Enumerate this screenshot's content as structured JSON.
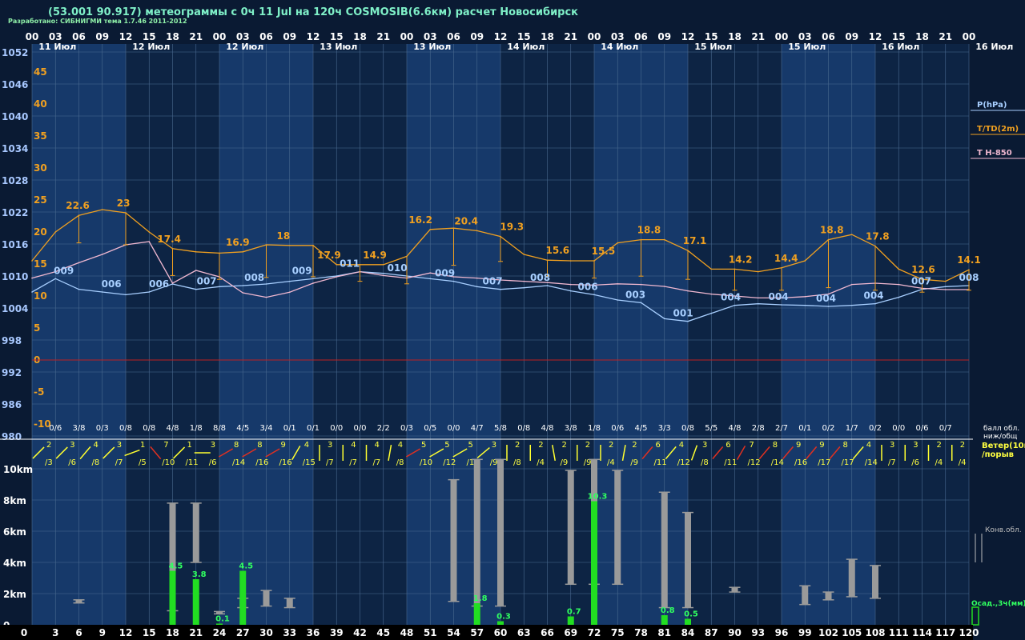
{
  "header": {
    "title": "(53.001 90.917) метеограммы с  0ч 11 Jul на 120ч COSMOSIB(6.6км) расчет Новосибирск",
    "credits": "Разработано: СИБНИГМИ тема 1.7.46 2011-2012"
  },
  "colors": {
    "background": "#0a1a33",
    "band_light": "#16396a",
    "band_dark": "#0d2444",
    "grid": "#4a6a8f",
    "pressure": "#a8cfff",
    "temperature": "#f0a020",
    "t850": "#f0b8d0",
    "zero_line": "#c02020",
    "cloud_bar": "#9a9a9a",
    "precip_bar": "#22dd22",
    "wind_normal": "#ffff30",
    "wind_strong": "#e03020",
    "label_yellow": "#ffff40",
    "label_green": "#30ff60"
  },
  "chart_data": {
    "type": "line",
    "x": [
      0,
      3,
      6,
      9,
      12,
      15,
      18,
      21,
      24,
      27,
      30,
      33,
      36,
      39,
      42,
      45,
      48,
      51,
      54,
      57,
      60,
      63,
      66,
      69,
      72,
      75,
      78,
      81,
      84,
      87,
      90,
      93,
      96,
      99,
      102,
      105,
      108,
      111,
      114,
      117,
      120
    ],
    "top_hour_labels": [
      "00",
      "03",
      "06",
      "09",
      "12",
      "15",
      "18",
      "21",
      "00",
      "03",
      "06",
      "09",
      "12",
      "15",
      "18",
      "21",
      "00",
      "03",
      "06",
      "09",
      "12",
      "15",
      "18",
      "21",
      "00",
      "03",
      "06",
      "09",
      "12",
      "15",
      "18",
      "21",
      "00",
      "03",
      "06",
      "09",
      "12",
      "15",
      "18",
      "21",
      "00"
    ],
    "bottom_hour_labels": [
      "0",
      "3",
      "6",
      "9",
      "12",
      "15",
      "18",
      "21",
      "24",
      "27",
      "30",
      "33",
      "36",
      "39",
      "42",
      "45",
      "48",
      "51",
      "54",
      "57",
      "60",
      "63",
      "66",
      "69",
      "72",
      "75",
      "78",
      "81",
      "84",
      "87",
      "90",
      "93",
      "96",
      "99",
      "102",
      "105",
      "108",
      "111",
      "114",
      "117",
      "120"
    ],
    "day_labels": [
      {
        "hour": 1,
        "text": "11 Июл"
      },
      {
        "hour": 13,
        "text": "12 Июл"
      },
      {
        "hour": 25,
        "text": "12 Июл"
      },
      {
        "hour": 37,
        "text": "13 Июл"
      },
      {
        "hour": 49,
        "text": "13 Июл"
      },
      {
        "hour": 61,
        "text": "14 Июл"
      },
      {
        "hour": 73,
        "text": "14 Июл"
      },
      {
        "hour": 85,
        "text": "15 Июл"
      },
      {
        "hour": 97,
        "text": "15 Июл"
      },
      {
        "hour": 109,
        "text": "16 Июл"
      },
      {
        "hour": 121,
        "text": "16 Июл"
      }
    ],
    "pressure_axis": {
      "ticks": [
        "1052",
        "1046",
        "1040",
        "1034",
        "1028",
        "1022",
        "1016",
        "1010",
        "1004",
        "998",
        "992",
        "986",
        "980"
      ],
      "range": [
        980,
        1054
      ]
    },
    "temperature_axis": {
      "ticks": [
        "45",
        "40",
        "35",
        "30",
        "25",
        "20",
        "15",
        "10",
        "5",
        "0",
        "-5",
        "-10"
      ]
    },
    "legend": [
      "P(hPa)",
      "T/TD(2m)",
      "T H-850"
    ],
    "series": [
      {
        "name": "P(hPa)",
        "values": [
          1007,
          1009.5,
          1007.5,
          1007,
          1006.5,
          1007,
          1008.5,
          1007.5,
          1008,
          1008.2,
          1008.5,
          1009,
          1009.5,
          1010,
          1010.8,
          1010.5,
          1010,
          1009.5,
          1009,
          1008,
          1007.5,
          1007.8,
          1008.2,
          1007.2,
          1006.5,
          1005.5,
          1005,
          1002,
          1001.5,
          1003,
          1004.5,
          1004.8,
          1004.6,
          1004.5,
          1004.3,
          1004.5,
          1004.8,
          1006,
          1007.5,
          1008,
          1008.2
        ]
      },
      {
        "name": "T/TD(2m)",
        "values": [
          15.5,
          20,
          22.6,
          23.5,
          23,
          20,
          17.4,
          16.9,
          16.7,
          16.9,
          18,
          17.9,
          17.9,
          14.9,
          14.9,
          14.9,
          16.2,
          20.4,
          20.6,
          20.2,
          19.3,
          16.5,
          15.6,
          15.5,
          15.5,
          18.3,
          18.8,
          18.8,
          17.1,
          14.2,
          14.2,
          13.8,
          14.4,
          15.5,
          18.8,
          19.6,
          17.8,
          14.2,
          12.6,
          12.3,
          14.1
        ]
      },
      {
        "name": "T H-850",
        "values": [
          12.8,
          13.8,
          15.2,
          16.5,
          18,
          18.5,
          12,
          14,
          13,
          10.5,
          9.8,
          10.6,
          12,
          13,
          13.8,
          13.2,
          12.8,
          13.6,
          13,
          12.8,
          12.5,
          12.3,
          12.1,
          11.8,
          11.7,
          11.9,
          11.8,
          11.5,
          10.8,
          10.3,
          10,
          9.7,
          9.7,
          9.9,
          10.3,
          11.8,
          12,
          11.8,
          11.2,
          11,
          11
        ]
      }
    ],
    "dewpoint_ticks": [
      15.5,
      17.8,
      18.3,
      18.2,
      18,
      17.9,
      13.2,
      12.9,
      12.6,
      12.8,
      12.9,
      13.0,
      13.0,
      11.8,
      12.3,
      11.4,
      11.9,
      12.9,
      14.8,
      15.5,
      15.4,
      13.4,
      13.1,
      12.9,
      12.8,
      13.4,
      13.1,
      13.0,
      12.6,
      10.8,
      10.9,
      10.6,
      10.9,
      11.0,
      11.3,
      11.2,
      10.9,
      10.6,
      10.6,
      10.6,
      10.9
    ],
    "pressure_labels": [
      {
        "hour": 6,
        "text": "009"
      },
      {
        "hour": 15,
        "text": "006"
      },
      {
        "hour": 24,
        "text": "006"
      },
      {
        "hour": 33,
        "text": "007"
      },
      {
        "hour": 42,
        "text": "008"
      },
      {
        "hour": 51,
        "text": "009"
      },
      {
        "hour": 60,
        "text": "011"
      },
      {
        "hour": 69,
        "text": "010"
      },
      {
        "hour": 78,
        "text": "009"
      },
      {
        "hour": 87,
        "text": "007"
      },
      {
        "hour": 96,
        "text": "008"
      },
      {
        "hour": 105,
        "text": "006"
      },
      {
        "hour": 114,
        "text": "003"
      },
      {
        "hour": 123,
        "text": "001"
      },
      {
        "hour": 132,
        "text": "004"
      },
      {
        "hour": 141,
        "text": "004"
      },
      {
        "hour": 150,
        "text": "004"
      },
      {
        "hour": 159,
        "text": "004"
      },
      {
        "hour": 168,
        "text": "007"
      },
      {
        "hour": 177,
        "text": "008"
      }
    ],
    "temperature_labels": [
      {
        "hour": 6,
        "text": "22.6"
      },
      {
        "hour": 12,
        "text": "23"
      },
      {
        "hour": 18,
        "text": "17.4"
      },
      {
        "hour": 27,
        "text": "16.9"
      },
      {
        "hour": 33,
        "text": "18"
      },
      {
        "hour": 39,
        "text": "17.9"
      },
      {
        "hour": 45,
        "text": "14.9"
      },
      {
        "hour": 51,
        "text": "16.2"
      },
      {
        "hour": 57,
        "text": "20.4"
      },
      {
        "hour": 63,
        "text": "19.3"
      },
      {
        "hour": 69,
        "text": "15.6"
      },
      {
        "hour": 75,
        "text": "15.5"
      },
      {
        "hour": 81,
        "text": "18.8"
      },
      {
        "hour": 87,
        "text": "17.1"
      },
      {
        "hour": 93,
        "text": "14.2"
      },
      {
        "hour": 99,
        "text": "14.4"
      },
      {
        "hour": 105,
        "text": "18.8"
      },
      {
        "hour": 111,
        "text": "17.8"
      },
      {
        "hour": 117,
        "text": "12.6"
      },
      {
        "hour": 123,
        "text": "14.1"
      }
    ],
    "cloudiness_label": "балл обл.\nниж/общ",
    "cloudiness": [
      "0/6",
      "3/8",
      "0/3",
      "0/8",
      "0/8",
      "4/8",
      "1/8",
      "8/8",
      "4/5",
      "3/4",
      "0/1",
      "0/1",
      "0/0",
      "0/0",
      "2/2",
      "0/3",
      "0/5",
      "0/0",
      "4/7",
      "5/8",
      "0/8",
      "4/8",
      "3/8",
      "1/8",
      "0/6",
      "4/5",
      "3/3",
      "0/8",
      "5/5",
      "4/8",
      "2/8",
      "2/7",
      "0/1",
      "0/2",
      "1/7",
      "0/2",
      "0/0",
      "0/6",
      "0/7"
    ],
    "wind_label": "Ветер(10м)\n/порыв",
    "wind": [
      {
        "speed": "2",
        "gust": "/3",
        "dir": 225,
        "strong": false
      },
      {
        "speed": "3",
        "gust": "/6",
        "dir": 225,
        "strong": false
      },
      {
        "speed": "4",
        "gust": "/8",
        "dir": 220,
        "strong": false
      },
      {
        "speed": "3",
        "gust": "/7",
        "dir": 225,
        "strong": false
      },
      {
        "speed": "1",
        "gust": "/5",
        "dir": 250,
        "strong": false
      },
      {
        "speed": "7",
        "gust": "/10",
        "dir": 140,
        "strong": true
      },
      {
        "speed": "1",
        "gust": "/11",
        "dir": 225,
        "strong": false
      },
      {
        "speed": "3",
        "gust": "/6",
        "dir": 270,
        "strong": false
      },
      {
        "speed": "8",
        "gust": "/14",
        "dir": 240,
        "strong": true
      },
      {
        "speed": "8",
        "gust": "/16",
        "dir": 240,
        "strong": true
      },
      {
        "speed": "9",
        "gust": "/16",
        "dir": 240,
        "strong": true
      },
      {
        "speed": "4",
        "gust": "/15",
        "dir": 210,
        "strong": false
      },
      {
        "speed": "3",
        "gust": "/7",
        "dir": 180,
        "strong": false
      },
      {
        "speed": "4",
        "gust": "/7",
        "dir": 180,
        "strong": false
      },
      {
        "speed": "4",
        "gust": "/7",
        "dir": 180,
        "strong": false
      },
      {
        "speed": "4",
        "gust": "/8",
        "dir": 190,
        "strong": false
      },
      {
        "speed": "5",
        "gust": "/10",
        "dir": 240,
        "strong": true
      },
      {
        "speed": "5",
        "gust": "/12",
        "dir": 240,
        "strong": false
      },
      {
        "speed": "5",
        "gust": "/12",
        "dir": 240,
        "strong": false
      },
      {
        "speed": "3",
        "gust": "/9",
        "dir": 230,
        "strong": false
      },
      {
        "speed": "2",
        "gust": "/8",
        "dir": 180,
        "strong": false
      },
      {
        "speed": "2",
        "gust": "/4",
        "dir": 180,
        "strong": false
      },
      {
        "speed": "2",
        "gust": "/9",
        "dir": 170,
        "strong": false
      },
      {
        "speed": "2",
        "gust": "/9",
        "dir": 180,
        "strong": false
      },
      {
        "speed": "2",
        "gust": "/4",
        "dir": 180,
        "strong": false
      },
      {
        "speed": "2",
        "gust": "/9",
        "dir": 190,
        "strong": false
      },
      {
        "speed": "6",
        "gust": "/11",
        "dir": 220,
        "strong": true
      },
      {
        "speed": "4",
        "gust": "/12",
        "dir": 220,
        "strong": false
      },
      {
        "speed": "3",
        "gust": "/8",
        "dir": 200,
        "strong": false
      },
      {
        "speed": "6",
        "gust": "/11",
        "dir": 220,
        "strong": true
      },
      {
        "speed": "7",
        "gust": "/12",
        "dir": 210,
        "strong": true
      },
      {
        "speed": "8",
        "gust": "/14",
        "dir": 220,
        "strong": true
      },
      {
        "speed": "9",
        "gust": "/16",
        "dir": 220,
        "strong": true
      },
      {
        "speed": "9",
        "gust": "/17",
        "dir": 220,
        "strong": true
      },
      {
        "speed": "8",
        "gust": "/17",
        "dir": 220,
        "strong": true
      },
      {
        "speed": "4",
        "gust": "/14",
        "dir": 220,
        "strong": false
      },
      {
        "speed": "3",
        "gust": "/7",
        "dir": 180,
        "strong": false
      },
      {
        "speed": "3",
        "gust": "/6",
        "dir": 180,
        "strong": false
      },
      {
        "speed": "2",
        "gust": "/4",
        "dir": 180,
        "strong": false
      },
      {
        "speed": "2",
        "gust": "/4",
        "dir": 180,
        "strong": false
      }
    ],
    "height_axis": {
      "ticks": [
        "10km",
        "8km",
        "6km",
        "4km",
        "2km",
        "0"
      ],
      "range_km": [
        0,
        10.5
      ]
    },
    "convective_label": "Конв.обл.",
    "precip_label": "Осад.,3ч(мм)",
    "convective_clouds": [
      {
        "hour": 6,
        "base": 1.4,
        "top": 1.6
      },
      {
        "hour": 18,
        "base": 0.9,
        "top": 7.8
      },
      {
        "hour": 21,
        "base": 4.0,
        "top": 7.8
      },
      {
        "hour": 24,
        "base": 0.7,
        "top": 0.85
      },
      {
        "hour": 27,
        "base": 1.1,
        "top": 1.7
      },
      {
        "hour": 30,
        "base": 1.2,
        "top": 2.2
      },
      {
        "hour": 33,
        "base": 1.1,
        "top": 1.7
      },
      {
        "hour": 54,
        "base": 1.5,
        "top": 9.3
      },
      {
        "hour": 57,
        "base": 1.2,
        "top": 10.6
      },
      {
        "hour": 60,
        "base": 1.2,
        "top": 10.6
      },
      {
        "hour": 69,
        "base": 2.6,
        "top": 9.9
      },
      {
        "hour": 72,
        "base": 2.6,
        "top": 10.6
      },
      {
        "hour": 75,
        "base": 2.6,
        "top": 9.9
      },
      {
        "hour": 81,
        "base": 1.1,
        "top": 8.5
      },
      {
        "hour": 84,
        "base": 1.1,
        "top": 7.2
      },
      {
        "hour": 90,
        "base": 2.1,
        "top": 2.4
      },
      {
        "hour": 99,
        "base": 1.3,
        "top": 2.5
      },
      {
        "hour": 102,
        "base": 1.6,
        "top": 2.1
      },
      {
        "hour": 105,
        "base": 1.8,
        "top": 4.2
      },
      {
        "hour": 108,
        "base": 1.7,
        "top": 3.8
      }
    ],
    "precipitation": [
      {
        "hour": 18,
        "mm": 4.5,
        "label": "4.5"
      },
      {
        "hour": 21,
        "mm": 3.8,
        "label": "3.8"
      },
      {
        "hour": 24,
        "mm": 0.1,
        "label": "0.1"
      },
      {
        "hour": 27,
        "mm": 4.5,
        "label": "4.5"
      },
      {
        "hour": 57,
        "mm": 1.8,
        "label": "1.8"
      },
      {
        "hour": 60,
        "mm": 0.3,
        "label": "0.3"
      },
      {
        "hour": 69,
        "mm": 0.7,
        "label": "0.7"
      },
      {
        "hour": 72,
        "mm": 10.3,
        "label": "10.3"
      },
      {
        "hour": 81,
        "mm": 0.8,
        "label": "0.8"
      },
      {
        "hour": 84,
        "mm": 0.5,
        "label": "0.5"
      }
    ]
  }
}
